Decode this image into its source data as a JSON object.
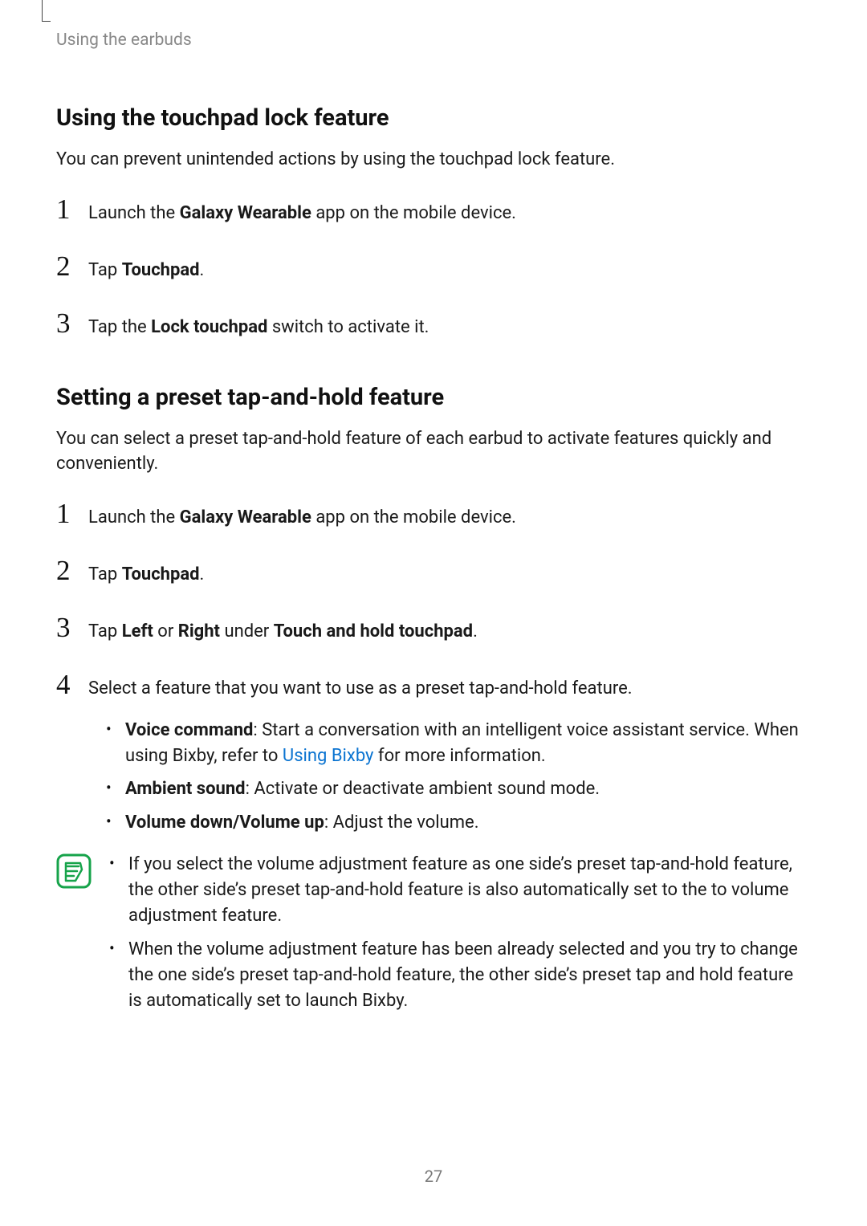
{
  "running_head": "Using the earbuds",
  "h1": "Using the touchpad lock feature",
  "p1": "You can prevent unintended actions by using the touchpad lock feature.",
  "s1_steps": [
    {
      "pre": "Launch the ",
      "b": "Galaxy Wearable",
      "post": " app on the mobile device."
    },
    {
      "pre": "Tap ",
      "b": "Touchpad",
      "post": "."
    },
    {
      "pre": "Tap the ",
      "b": "Lock touchpad",
      "post": " switch to activate it."
    }
  ],
  "h2": "Setting a preset tap-and-hold feature",
  "p2": "You can select a preset tap-and-hold feature of each earbud to activate features quickly and conveniently.",
  "s2_steps": {
    "a": {
      "pre": "Launch the ",
      "b": "Galaxy Wearable",
      "post": " app on the mobile device."
    },
    "b": {
      "pre": "Tap ",
      "b": "Touchpad",
      "post": "."
    },
    "c": {
      "pre": "Tap ",
      "b1": "Left",
      "mid": " or ",
      "b2": "Right",
      "mid2": " under ",
      "b3": "Touch and hold touchpad",
      "post": "."
    },
    "d": "Select a feature that you want to use as a preset tap-and-hold feature."
  },
  "bullets": {
    "voice": {
      "b": "Voice command",
      "t1": ": Start a conversation with an intelligent voice assistant service. When using Bixby, refer to ",
      "link": "Using Bixby",
      "t2": " for more information."
    },
    "ambient": {
      "b": "Ambient sound",
      "t": ": Activate or deactivate ambient sound mode."
    },
    "volume": {
      "b": "Volume down/Volume up",
      "t": ": Adjust the volume."
    }
  },
  "notes": [
    "If you select the volume adjustment feature as one side’s preset tap-and-hold feature, the other side’s preset tap-and-hold feature is also automatically set to the to volume adjustment feature.",
    "When the volume adjustment feature has been already selected and you try to change the one side’s preset tap-and-hold feature, the other side’s preset tap and hold feature is automatically set to launch Bixby."
  ],
  "page_number": "27"
}
